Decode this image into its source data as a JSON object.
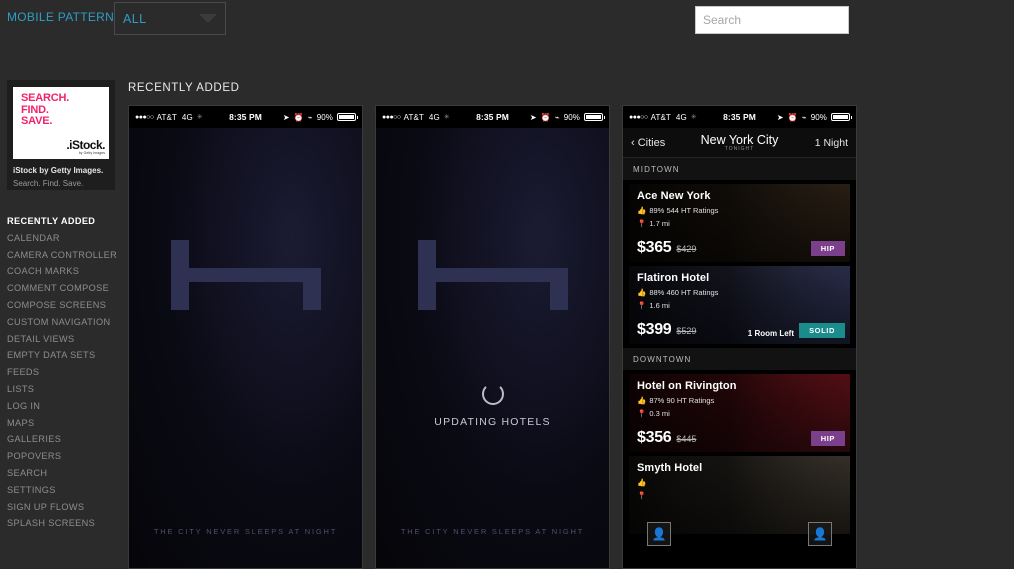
{
  "header": {
    "brand": "MOBILE PATTERNS",
    "filter_value": "ALL",
    "filter_icon": "chevron-down-icon",
    "search_placeholder": "Search",
    "search_value": ""
  },
  "sidebar": {
    "ad": {
      "line1": "SEARCH.",
      "line2": "FIND.",
      "line3": "SAVE.",
      "logo": ".iStock.",
      "logo_sub": "by Getty Images",
      "title": "iStock by Getty Images.",
      "subtitle": "Search. Find. Save."
    },
    "items": [
      {
        "label": "RECENTLY ADDED",
        "active": true
      },
      {
        "label": "CALENDAR",
        "active": false
      },
      {
        "label": "CAMERA CONTROLLER",
        "active": false
      },
      {
        "label": "COACH MARKS",
        "active": false
      },
      {
        "label": "COMMENT COMPOSE",
        "active": false
      },
      {
        "label": "COMPOSE SCREENS",
        "active": false
      },
      {
        "label": "CUSTOM NAVIGATION",
        "active": false
      },
      {
        "label": "DETAIL VIEWS",
        "active": false
      },
      {
        "label": "EMPTY DATA SETS",
        "active": false
      },
      {
        "label": "FEEDS",
        "active": false
      },
      {
        "label": "LISTS",
        "active": false
      },
      {
        "label": "LOG IN",
        "active": false
      },
      {
        "label": "MAPS",
        "active": false
      },
      {
        "label": "GALLERIES",
        "active": false
      },
      {
        "label": "POPOVERS",
        "active": false
      },
      {
        "label": "SEARCH",
        "active": false
      },
      {
        "label": "SETTINGS",
        "active": false
      },
      {
        "label": "SIGN UP FLOWS",
        "active": false
      },
      {
        "label": "SPLASH SCREENS",
        "active": false
      }
    ]
  },
  "main": {
    "section_title": "RECENTLY ADDED"
  },
  "status_bar": {
    "signal_dots": "●●●○○",
    "carrier": "AT&T",
    "network": "4G",
    "time": "8:35 PM",
    "location_icon": "location-arrow-icon",
    "alarm_icon": "alarm-clock-icon",
    "bluetooth_icon": "bluetooth-icon",
    "battery_pct": "90%"
  },
  "phone1": {
    "tagline": "THE CITY NEVER SLEEPS AT NIGHT",
    "logo_icon": "bed-logo-icon"
  },
  "phone2": {
    "tagline": "THE CITY NEVER SLEEPS AT NIGHT",
    "loading_text": "UPDATING HOTELS",
    "spinner_icon": "loading-spinner-icon"
  },
  "phone3": {
    "nav": {
      "back_label": "‹ Cities",
      "back_icon": "chevron-left-icon",
      "title": "New York City",
      "subtitle": "TONIGHT",
      "right_label": "1 Night"
    },
    "sections": [
      {
        "name": "MIDTOWN",
        "hotels": [
          {
            "name": "Ace New York",
            "rating": "89% 544 HT Ratings",
            "distance": "1.7 mi",
            "price": "$365",
            "price_old": "$429",
            "badge": "HIP",
            "badge_color": "#7b3f8c",
            "rooms_left": "",
            "thumb_icon": "hotel-photo"
          },
          {
            "name": "Flatiron Hotel",
            "rating": "88% 460 HT Ratings",
            "distance": "1.6 mi",
            "price": "$399",
            "price_old": "$529",
            "badge": "SOLID",
            "badge_color": "#1a8c8c",
            "rooms_left": "1 Room Left",
            "thumb_icon": "hotel-photo"
          }
        ]
      },
      {
        "name": "DOWNTOWN",
        "hotels": [
          {
            "name": "Hotel on Rivington",
            "rating": "87% 90 HT Ratings",
            "distance": "0.3 mi",
            "price": "$356",
            "price_old": "$445",
            "badge": "HIP",
            "badge_color": "#7b3f8c",
            "rooms_left": "",
            "thumb_icon": "hotel-photo"
          },
          {
            "name": "Smyth Hotel",
            "rating": "",
            "distance": "",
            "price": "",
            "price_old": "",
            "badge": "",
            "badge_color": "",
            "rooms_left": "",
            "thumb_icon": "hotel-photo"
          }
        ]
      }
    ],
    "icons": {
      "thumbs_up": "👍",
      "pin": "●",
      "person_left": "person-outline-icon",
      "person_right": "person-filled-icon"
    }
  },
  "colors": {
    "accent": "#2f9dc4",
    "page_bg": "#2b2b2b",
    "hip": "#7b3f8c",
    "solid": "#1a8c8c",
    "ad_pink": "#f0246c"
  }
}
